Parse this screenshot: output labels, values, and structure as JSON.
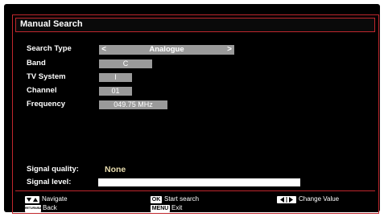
{
  "title": "Manual Search",
  "fields": {
    "search_type": {
      "label": "Search Type",
      "value": "Analogue",
      "left_arrow": "<",
      "right_arrow": ">"
    },
    "band": {
      "label": "Band",
      "value": "C"
    },
    "tv_system": {
      "label": "TV System",
      "value": "I"
    },
    "channel": {
      "label": "Channel",
      "value": "01"
    },
    "frequency": {
      "label": "Frequency",
      "value": "049.75 MHz"
    }
  },
  "signal": {
    "quality_label": "Signal quality:",
    "quality_value": "None",
    "level_label": "Signal level:",
    "level_fraction": 1.0
  },
  "footer": {
    "navigate_label": "Navigate",
    "back_key": "RETURN/BACK",
    "back_label": "Back",
    "ok_key": "OK",
    "start_label": "Start search",
    "menu_key": "MENU",
    "exit_label": "Exit",
    "change_label": "Change Value"
  },
  "colors": {
    "background": "#000000",
    "accent_red": "#c0272d",
    "field_grey": "#9a9a9a",
    "signal_value": "#e8dcae"
  }
}
